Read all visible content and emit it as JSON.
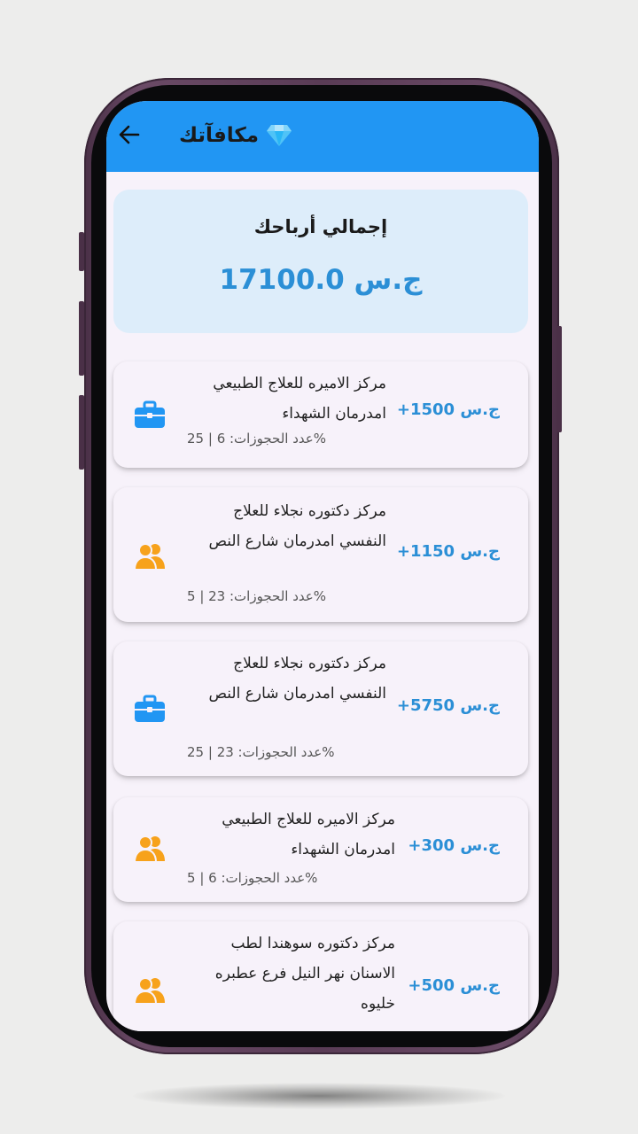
{
  "appbar": {
    "title": "مكافآتك",
    "back_icon": "arrow-back-icon",
    "title_icon": "diamond-icon",
    "color": "#2196f3"
  },
  "summary": {
    "label": "إجمالي أرباحك",
    "amount": "ج.س 17100.0"
  },
  "rewards": [
    {
      "amount": "ج.س 1500+",
      "name": "مركز الاميره للعلاج الطبيعي امدرمان الشهداء",
      "stats": "%عدد الحجوزات: 6 | 25",
      "icon": "briefcase-icon"
    },
    {
      "amount": "ج.س 1150+",
      "name": "مركز دكتوره نجلاء للعلاج النفسي امدرمان شارع النص",
      "stats": "%عدد الحجوزات: 23 | 5",
      "icon": "people-icon"
    },
    {
      "amount": "ج.س 5750+",
      "name": "مركز دكتوره نجلاء للعلاج النفسي امدرمان شارع النص",
      "stats": "%عدد الحجوزات: 23 | 25",
      "icon": "briefcase-icon"
    },
    {
      "amount": "ج.س 300+",
      "name": "مركز الاميره للعلاج الطبيعي امدرمان الشهداء",
      "stats": "%عدد الحجوزات: 6 | 5",
      "icon": "people-icon"
    },
    {
      "amount": "ج.س 500+",
      "name": "مركز دكتوره سوهندا لطب الاسنان نهر النيل  فرع عطبره خليوه",
      "stats": "",
      "icon": "people-icon"
    }
  ],
  "colors": {
    "accent_blue": "#2b8fd6",
    "icon_blue": "#2196f3",
    "icon_orange": "#f7a21b",
    "card_bg": "#f7f2fa",
    "summary_bg": "#ddedfa"
  }
}
